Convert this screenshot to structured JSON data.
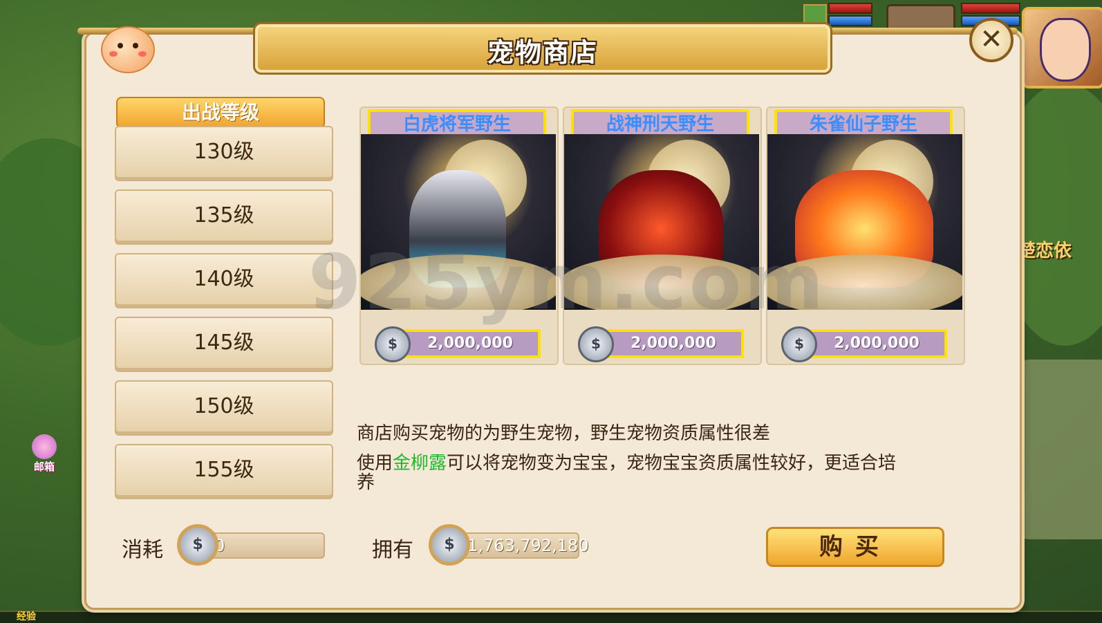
{
  "window": {
    "title": "宠物商店"
  },
  "hud": {
    "player_name_partial": "楚恋依"
  },
  "mail": {
    "label": "邮箱"
  },
  "bottom": {
    "exp_label": "经验"
  },
  "level_panel": {
    "header": "出战等级",
    "levels": [
      "130级",
      "135级",
      "140级",
      "145级",
      "150级",
      "155级"
    ]
  },
  "pets": [
    {
      "name": "白虎将军野生",
      "price": "2,000,000"
    },
    {
      "name": "战神刑天野生",
      "price": "2,000,000"
    },
    {
      "name": "朱雀仙子野生",
      "price": "2,000,000"
    }
  ],
  "currency_icon_glyph": "$",
  "description": {
    "line1": "商店购买宠物的为野生宠物，野生宠物资质属性很差",
    "line2_prefix": "使用",
    "line2_highlight": "金柳露",
    "line2_suffix": "可以将宠物变为宝宝，宠物宝宝资质属性较好，更适合培养"
  },
  "footer": {
    "cost_label": "消耗",
    "cost_value": "0",
    "own_label": "拥有",
    "own_value": "1,763,792,180",
    "buy_button": "购买"
  },
  "watermark": "925ym.com",
  "colors": {
    "highlight_green": "#1fb82e",
    "price_border_yellow": "#ffe200",
    "name_text_blue": "#3c8dff",
    "panel_bg": "#f4e9d6"
  },
  "icons": [
    "close-icon",
    "silver-coin-icon",
    "mascot-icon",
    "mail-icon"
  ]
}
